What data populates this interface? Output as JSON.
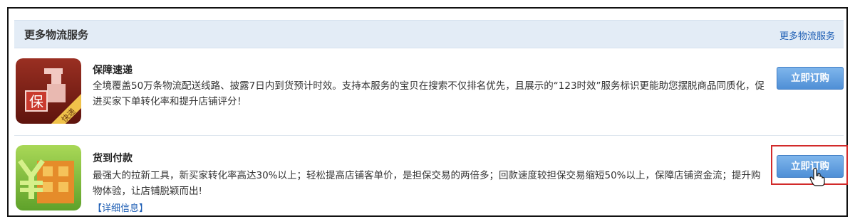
{
  "header": {
    "title": "更多物流服务",
    "link_label": "更多物流服务"
  },
  "services": [
    {
      "title": "保障速递",
      "description": "全境覆盖50万条物流配送线路、披露7日内到货预计时效。支持本服务的宝贝在搜索不仅排名优先，且展示的“123时效”服务标识更能助您摆脱商品同质化，促进买家下单转化率和提升店铺评分！",
      "button_label": "立即订购",
      "icon_text_main": "保",
      "icon_text_ribbon": "快递"
    },
    {
      "title": "货到付款",
      "description": "最强大的拉新工具，新买家转化率高达30%以上；轻松提高店铺客单价，是担保交易的两倍多；回款速度较担保交易缩短50%以上，保障店铺资金流；提升购物体验，让店铺脱颖而出!",
      "detail_link": "【详细信息】",
      "button_label": "立即订购",
      "icon_text_main": "¥"
    }
  ],
  "colors": {
    "header_bg": "#e3ecf6",
    "link": "#1f5fb5",
    "button": "#5b9ade",
    "highlight": "#d22a2a"
  }
}
